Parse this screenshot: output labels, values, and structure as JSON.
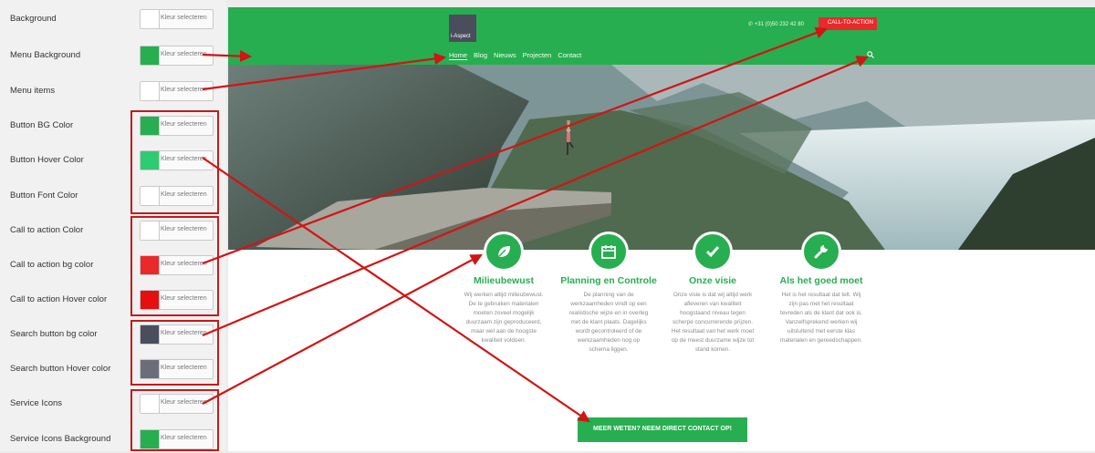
{
  "panel": {
    "button_text": "Kleur selecteren",
    "settings": [
      {
        "label": "Background",
        "color": "#ffffff"
      },
      {
        "label": "Menu Background",
        "color": "#27ae50"
      },
      {
        "label": "Menu items",
        "color": "#ffffff"
      },
      {
        "label": "Button BG Color",
        "color": "#27ae50"
      },
      {
        "label": "Button Hover Color",
        "color": "#2ecc71"
      },
      {
        "label": "Button Font Color",
        "color": "#ffffff"
      },
      {
        "label": "Call to action Color",
        "color": "#ffffff"
      },
      {
        "label": "Call to action bg color",
        "color": "#e82a2a"
      },
      {
        "label": "Call to action Hover color",
        "color": "#e50f0f"
      },
      {
        "label": "Search button bg color",
        "color": "#4a4d5c"
      },
      {
        "label": "Search button Hover color",
        "color": "#6b6e7a"
      },
      {
        "label": "Service Icons",
        "color": "#ffffff"
      },
      {
        "label": "Service Icons Background",
        "color": "#27ae50"
      }
    ]
  },
  "site": {
    "logo_text": "i-Aspect",
    "phone": "+31 (0)50 232 42 80",
    "cta_label": "CALL-TO-ACTION",
    "nav": [
      "Home",
      "Blog",
      "Nieuws",
      "Projecten",
      "Contact"
    ],
    "services": [
      {
        "icon": "leaf-icon",
        "title": "Milieubewust",
        "text": "Wij werken altijd milieubewust. De te gebruiken materialen moeten zoveel mogelijk duurzaam zijn geproduceerd, maar wel aan de hoogste kwaliteit voldoen."
      },
      {
        "icon": "calendar-icon",
        "title": "Planning en Controle",
        "text": "De planning van de werkzaamheden vindt op een realistische wijze en in overleg met de klant plaats. Dagelijks wordt gecontroleerd of de werkzaamheden nog op schema liggen."
      },
      {
        "icon": "checkmark-icon",
        "title": "Onze visie",
        "text": "Onze visie is dat wij altijd werk afleveren van kwaliteit hoogstaand niveau tegen scherpe concurrerende prijzen. Het resultaat van het werk moet op de meest duurzame wijze tot stand komen."
      },
      {
        "icon": "wrench-icon",
        "title": "Als het goed moet",
        "text": "Het is het resultaat dat telt. Wij zijn pas met het resultaat tevreden als de klant dat ook is. Vanzelfsprekend werken wij uitsluitend met eerste klas materialen en gereedschappen."
      }
    ],
    "contact_button": "MEER WETEN? NEEM DIRECT CONTACT OP!"
  },
  "colors": {
    "menu_bg": "#27ae50",
    "cta_bg": "#e82a2a",
    "annotation_red": "#c51a1a"
  }
}
